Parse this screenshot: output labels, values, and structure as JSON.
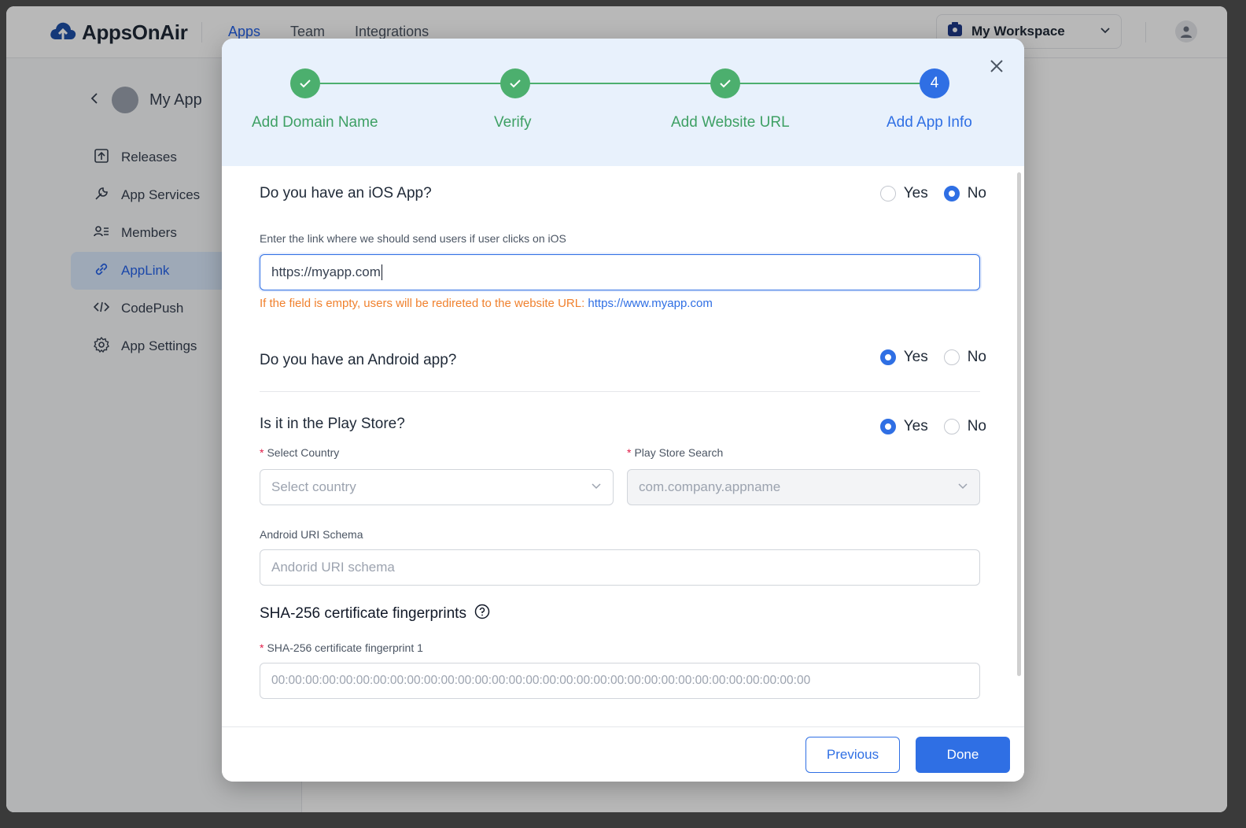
{
  "app": {
    "brand": "AppsOnAir",
    "nav": [
      "Apps",
      "Team",
      "Integrations"
    ],
    "workspace": "My Workspace",
    "app_name": "My App",
    "sidebar": [
      {
        "label": "Releases",
        "icon": "upload-box-icon"
      },
      {
        "label": "App Services",
        "icon": "wrench-icon"
      },
      {
        "label": "Members",
        "icon": "members-icon"
      },
      {
        "label": "AppLink",
        "icon": "link-icon",
        "active": true
      },
      {
        "label": "CodePush",
        "icon": "code-icon"
      },
      {
        "label": "App Settings",
        "icon": "gear-icon"
      }
    ]
  },
  "modal": {
    "steps": [
      {
        "label": "Add Domain Name",
        "status": "done"
      },
      {
        "label": "Verify",
        "status": "done"
      },
      {
        "label": "Add Website URL",
        "status": "done"
      },
      {
        "label": "Add App Info",
        "status": "current",
        "number": "4"
      }
    ],
    "ios": {
      "question": "Do you have an iOS App?",
      "yes": "Yes",
      "no": "No",
      "selected": "No",
      "link_label": "Enter the link where we should send users if user clicks on iOS",
      "link_value": "https://myapp.com",
      "hint": "If the field is empty, users will be redireted to the website URL:",
      "hint_link": "https://www.myapp.com"
    },
    "android": {
      "question": "Do you have an Android app?",
      "yes": "Yes",
      "no": "No",
      "selected": "Yes"
    },
    "play_store": {
      "question": "Is it in the Play Store?",
      "yes": "Yes",
      "no": "No",
      "selected": "Yes",
      "country_label": "Select Country",
      "country_placeholder": "Select country",
      "search_label": "Play Store Search",
      "search_placeholder": "com.company.appname"
    },
    "uri_schema": {
      "label": "Android URI Schema",
      "placeholder": "Andorid URI schema"
    },
    "sha": {
      "section_title": "SHA-256 certificate fingerprints",
      "field_label": "SHA-256 certificate fingerprint 1",
      "placeholder": "00:00:00:00:00:00:00:00:00:00:00:00:00:00:00:00:00:00:00:00:00:00:00:00:00:00:00:00:00:00:00:00"
    },
    "buttons": {
      "previous": "Previous",
      "done": "Done"
    }
  },
  "colors": {
    "primary": "#2f6fe4",
    "success": "#4caf6e",
    "warning": "#f0812e",
    "header_bg": "#e8f1fc"
  }
}
